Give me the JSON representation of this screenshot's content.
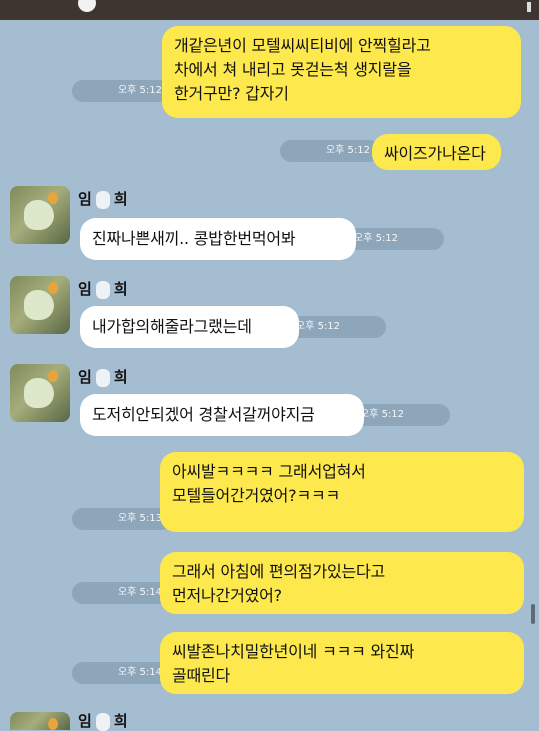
{
  "chat": {
    "contact": {
      "name_first": "임",
      "name_last": "희"
    },
    "messages": [
      {
        "sender": "me",
        "lines": [
          "개같은년이 모텔씨씨티비에 안찍힐라고",
          "차에서 쳐 내리고 못걷는척 생지랄을",
          "한거구만? 갑자기"
        ],
        "time": "오후 5:12"
      },
      {
        "sender": "me",
        "lines": [
          "싸이즈가나온다"
        ],
        "time": "오후 5:12"
      },
      {
        "sender": "them",
        "lines": [
          "진짜나쁜새끼.. 콩밥한번먹어봐"
        ],
        "time": "오후 5:12"
      },
      {
        "sender": "them",
        "lines": [
          "내가합의해줄라그랬는데"
        ],
        "time": "오후 5:12"
      },
      {
        "sender": "them",
        "lines": [
          "도저히안되겠어 경찰서갈꺼야지금"
        ],
        "time": "오후 5:12"
      },
      {
        "sender": "me",
        "lines": [
          "아씨발ㅋㅋㅋㅋ 그래서업혀서",
          "모텔들어간거였어?ㅋㅋㅋ"
        ],
        "time": "오후 5:13"
      },
      {
        "sender": "me",
        "lines": [
          "그래서 아침에 편의점가있는다고",
          "먼저나간거였어?"
        ],
        "time": "오후 5:14"
      },
      {
        "sender": "me",
        "lines": [
          "씨발존나치밀한년이네 ㅋㅋㅋ 와진짜",
          "골때린다"
        ],
        "time": "오후 5:14"
      }
    ]
  }
}
